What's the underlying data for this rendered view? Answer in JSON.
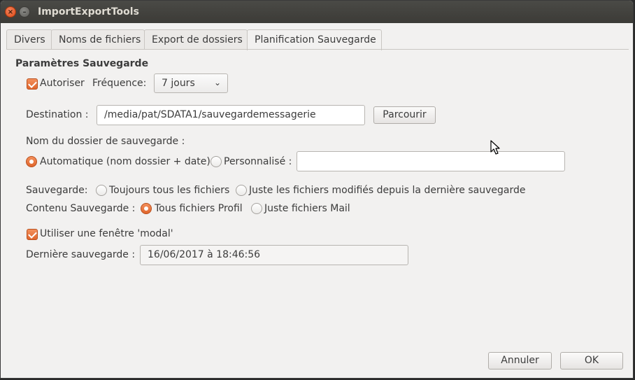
{
  "window": {
    "title": "ImportExportTools"
  },
  "tabs": [
    {
      "label": "Divers"
    },
    {
      "label": "Noms de fichiers"
    },
    {
      "label": "Export de dossiers"
    },
    {
      "label": "Planification Sauvegarde"
    }
  ],
  "active_tab": "Planification Sauvegarde",
  "section": {
    "title": "Paramètres Sauvegarde"
  },
  "enable": {
    "label": "Autoriser",
    "checked": true
  },
  "frequency": {
    "label": "Fréquence:",
    "value": "7 jours"
  },
  "destination": {
    "label": "Destination :",
    "value": "/media/pat/SDATA1/sauvegardemessagerie",
    "browse_label": "Parcourir"
  },
  "folder_name": {
    "label": "Nom du dossier de sauvegarde :",
    "auto_label": "Automatique (nom dossier + date)",
    "custom_label": "Personnalisé :",
    "custom_value": "",
    "selected": "auto"
  },
  "backup": {
    "label": "Sauvegarde:",
    "always_label": "Toujours tous les fichiers",
    "modified_label": "Juste les fichiers modifiés depuis la dernière sauvegarde"
  },
  "content": {
    "label": "Contenu Sauvegarde :",
    "profile_label": "Tous fichiers Profil",
    "mail_label": "Juste fichiers Mail",
    "selected": "profile"
  },
  "modal": {
    "label": "Utiliser une fenêtre 'modal'",
    "checked": true
  },
  "last_backup": {
    "label": "Dernière sauvegarde :",
    "value": "16/06/2017 à 18:46:56"
  },
  "actions": {
    "cancel_label": "Annuler",
    "ok_label": "OK"
  },
  "colors": {
    "accent": "#e6642c",
    "titlebar": "#3c3b37",
    "background": "#f2f1f0"
  }
}
